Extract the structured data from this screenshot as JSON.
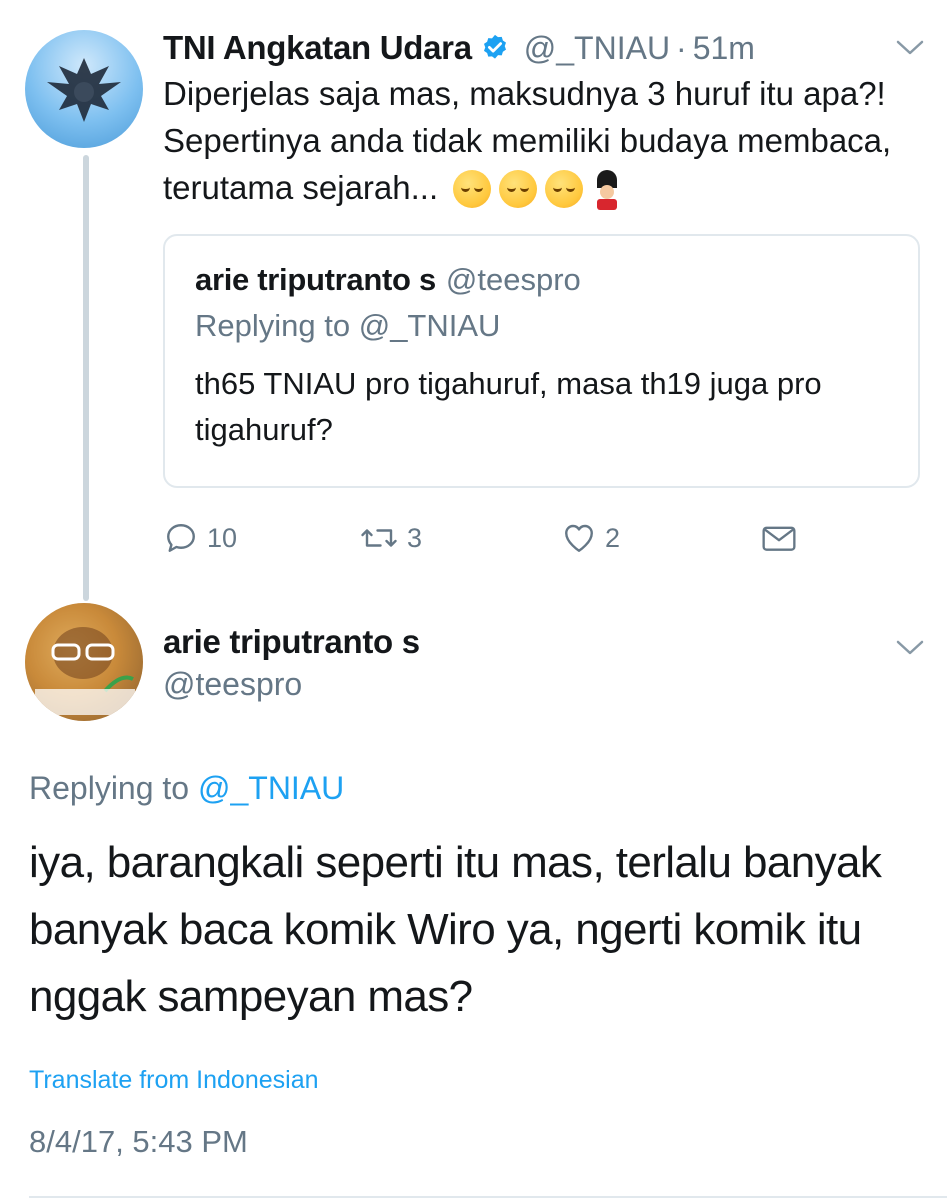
{
  "tweet1": {
    "display_name": "TNI Angkatan Udara",
    "handle": "@_TNIAU",
    "separator": "·",
    "time": "51m",
    "text": "Diperjelas saja mas, maksudnya 3 huruf itu apa?! Sepertinya anda tidak memiliki budaya membaca, terutama sejarah...",
    "emojis": [
      "relieved-face",
      "relieved-face",
      "relieved-face",
      "guardsman"
    ],
    "quote": {
      "display_name": "arie triputranto s",
      "handle": "@teespro",
      "replying_prefix": "Replying to ",
      "replying_handle": "@_TNIAU",
      "text": "th65 TNIAU pro tigahuruf, masa th19 juga pro tigahuruf?"
    },
    "actions": {
      "replies": "10",
      "retweets": "3",
      "likes": "2"
    }
  },
  "tweet2": {
    "display_name": "arie triputranto s",
    "handle": "@teespro",
    "replying_prefix": "Replying to ",
    "replying_handle": "@_TNIAU",
    "text": "iya, barangkali seperti itu mas, terlalu banyak banyak baca komik Wiro ya, ngerti komik itu nggak sampeyan mas?",
    "translate_label": "Translate from Indonesian",
    "timestamp": "8/4/17, 5:43 PM"
  },
  "colors": {
    "link": "#1da1f2",
    "muted": "#657786",
    "text": "#14171a",
    "border": "#e1e8ed",
    "thread_line": "#ccd6dd"
  }
}
